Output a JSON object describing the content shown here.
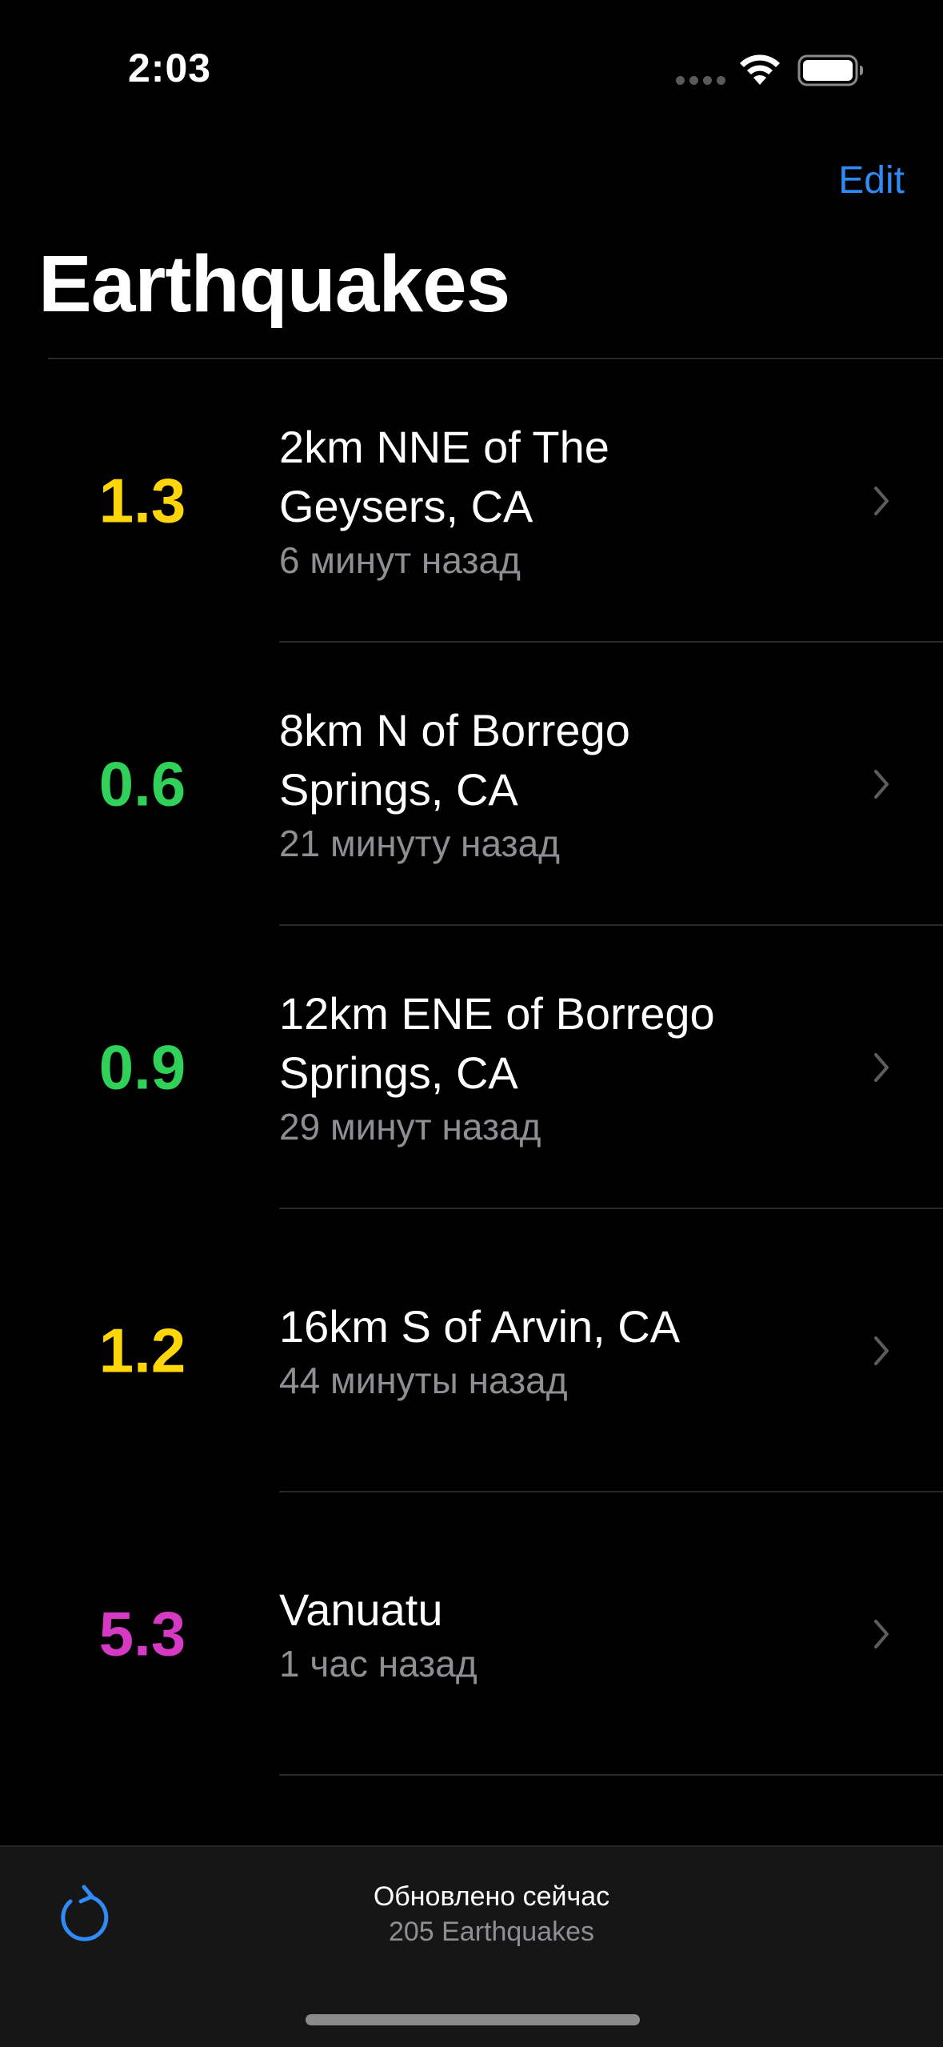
{
  "status_bar": {
    "time": "2:03"
  },
  "nav": {
    "edit_label": "Edit",
    "title": "Earthquakes"
  },
  "colors": {
    "accent": "#2f8cf6",
    "mag_yellow": "#ffd60a",
    "mag_green": "#30d158",
    "mag_magenta": "#d63ac4"
  },
  "quakes": [
    {
      "magnitude": "1.3",
      "place": "2km NNE of The Geysers, CA",
      "time": "6 минут назад",
      "color": "#ffd60a"
    },
    {
      "magnitude": "0.6",
      "place": "8km N of Borrego Springs, CA",
      "time": "21 минуту назад",
      "color": "#30d158"
    },
    {
      "magnitude": "0.9",
      "place": "12km ENE of Borrego Springs, CA",
      "time": "29 минут назад",
      "color": "#30d158"
    },
    {
      "magnitude": "1.2",
      "place": "16km S of Arvin, CA",
      "time": "44 минуты назад",
      "color": "#ffd60a"
    },
    {
      "magnitude": "5.3",
      "place": "Vanuatu",
      "time": "1 час назад",
      "color": "#d63ac4"
    }
  ],
  "partial_row_text": "",
  "toolbar": {
    "refresh_icon": "refresh-icon",
    "updated_label": "Обновлено сейчас",
    "count_label": "205 Earthquakes"
  }
}
